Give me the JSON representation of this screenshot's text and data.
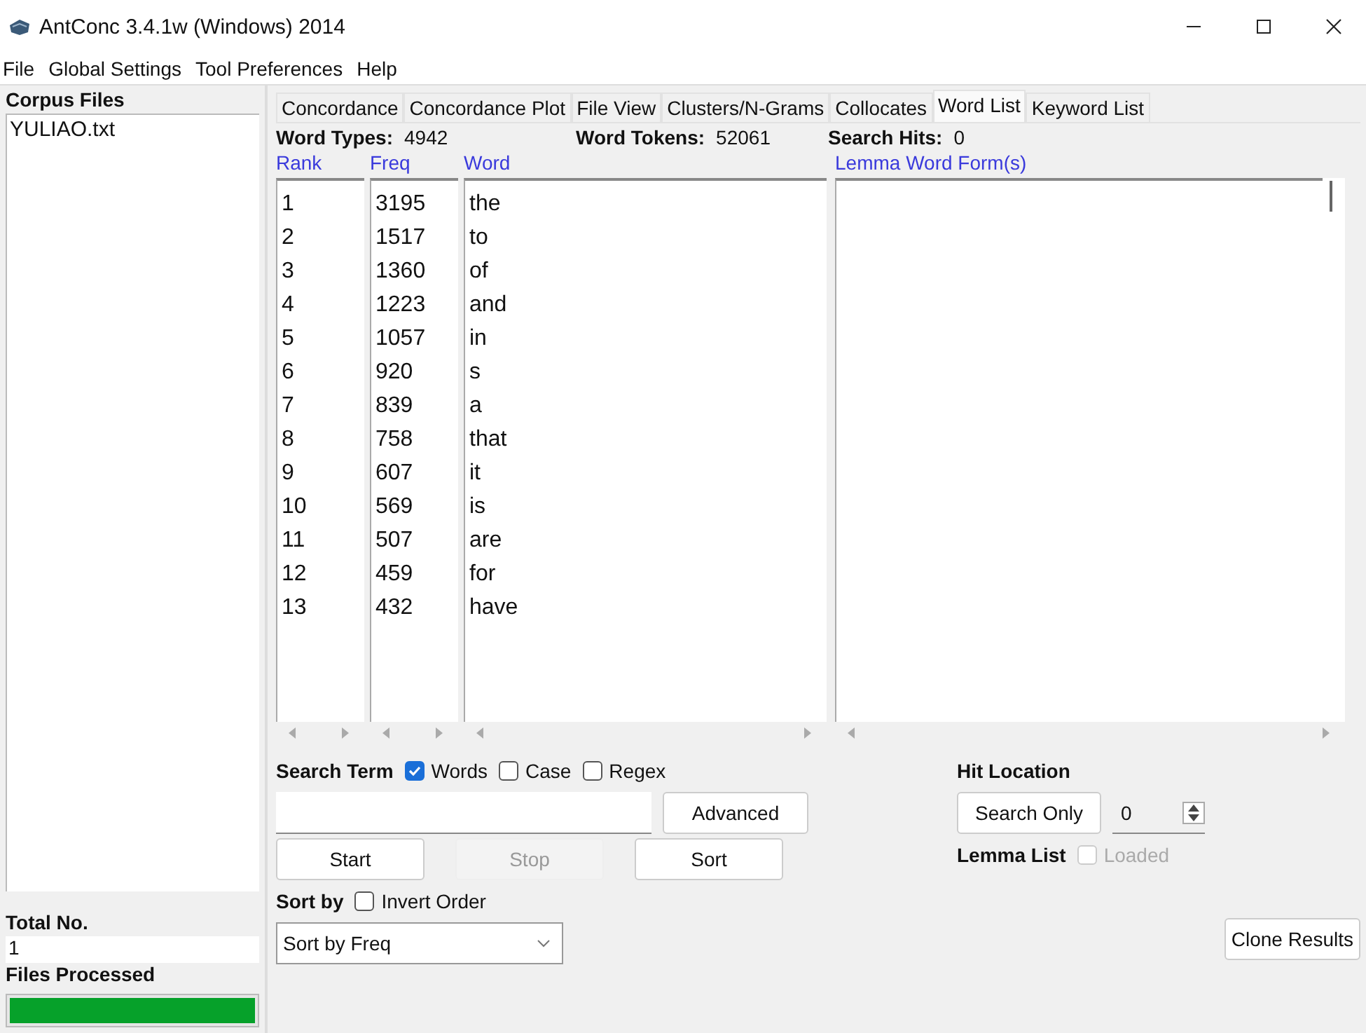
{
  "window": {
    "title": "AntConc 3.4.1w (Windows) 2014"
  },
  "menu": [
    "File",
    "Global Settings",
    "Tool Preferences",
    "Help"
  ],
  "sidebar": {
    "corpus_heading": "Corpus Files",
    "files": [
      {
        "name": "YULIAO.txt",
        "selected": false
      }
    ],
    "total_label": "Total No.",
    "total_value": "1",
    "processed_label": "Files Processed",
    "progress": {
      "level": 1.0
    }
  },
  "tabs": [
    {
      "label": "Concordance",
      "selected": false
    },
    {
      "label": "Concordance Plot",
      "selected": false
    },
    {
      "label": "File View",
      "selected": false
    },
    {
      "label": "Clusters/N-Grams",
      "selected": false
    },
    {
      "label": "Collocates",
      "selected": false
    },
    {
      "label": "Word List",
      "selected": true
    },
    {
      "label": "Keyword List",
      "selected": false
    }
  ],
  "stats": [
    {
      "label": "Word Types:",
      "value": "4942"
    },
    {
      "label": "Word Tokens:",
      "value": "52061"
    },
    {
      "label": "Search Hits:",
      "value": "0"
    }
  ],
  "table": {
    "columns": [
      "Rank",
      "Freq",
      "Word"
    ],
    "rows": [
      [
        "1",
        "3195",
        "the"
      ],
      [
        "2",
        "1517",
        "to"
      ],
      [
        "3",
        "1360",
        "of"
      ],
      [
        "4",
        "1223",
        "and"
      ],
      [
        "5",
        "1057",
        "in"
      ],
      [
        "6",
        "920",
        "s"
      ],
      [
        "7",
        "839",
        "a"
      ],
      [
        "8",
        "758",
        "that"
      ],
      [
        "9",
        "607",
        "it"
      ],
      [
        "10",
        "569",
        "is"
      ],
      [
        "11",
        "507",
        "are"
      ],
      [
        "12",
        "459",
        "for"
      ],
      [
        "13",
        "432",
        "have"
      ]
    ]
  },
  "lemma": {
    "heading": "Lemma Word Form(s)"
  },
  "search": {
    "label": "Search Term",
    "options": [
      {
        "label": "Words",
        "checked": true,
        "disabled": false
      },
      {
        "label": "Case",
        "checked": false,
        "disabled": false
      },
      {
        "label": "Regex",
        "checked": false,
        "disabled": false
      }
    ],
    "advanced": "Advanced"
  },
  "buttons": [
    {
      "label": "Start",
      "disabled": false
    },
    {
      "label": "Stop",
      "disabled": true
    },
    {
      "label": "Sort",
      "disabled": false
    }
  ],
  "hit_location": {
    "label": "Hit Location",
    "button": "Search Only",
    "value": "0"
  },
  "lemma_list": {
    "label": "Lemma List",
    "option": {
      "label": "Loaded",
      "checked": false,
      "disabled": true
    }
  },
  "sort": {
    "label": "Sort by",
    "invert": {
      "label": "Invert Order",
      "checked": false,
      "disabled": false
    },
    "value": "Sort by Freq"
  },
  "clone": "Clone Results"
}
